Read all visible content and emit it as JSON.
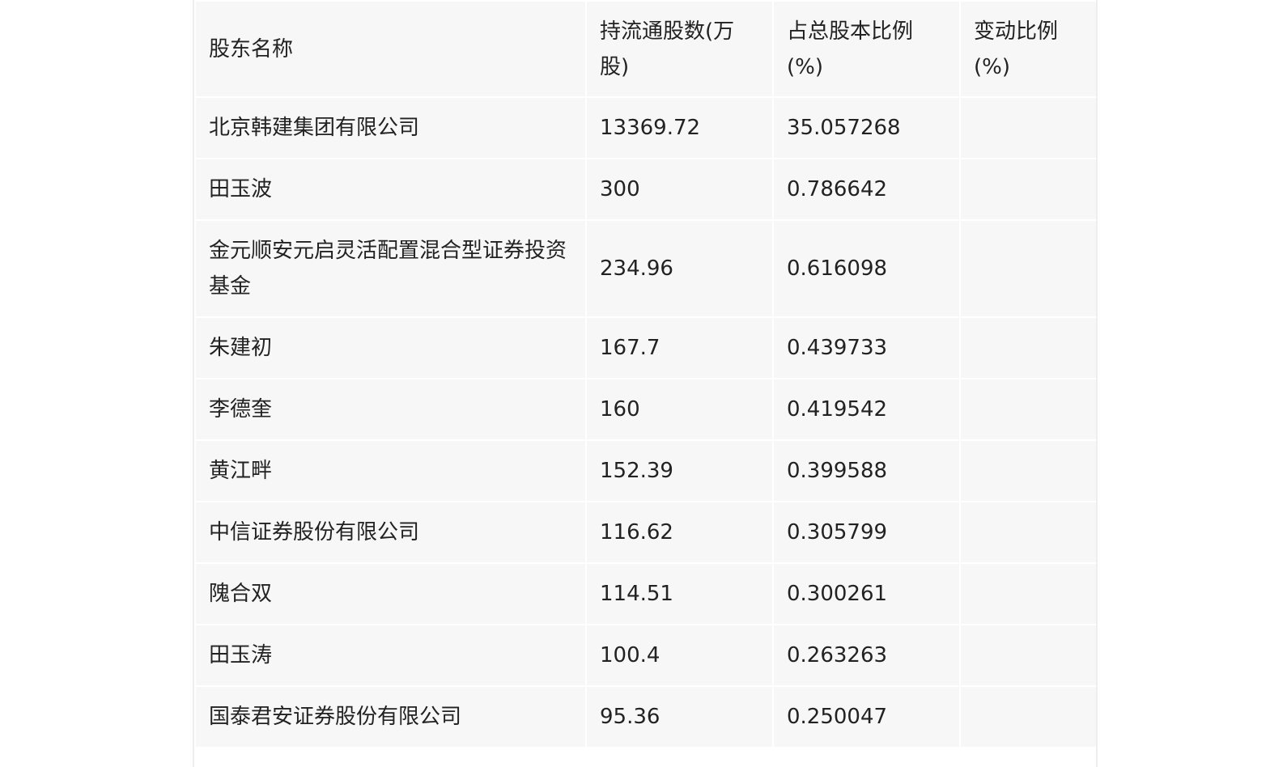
{
  "table": {
    "headers": {
      "name": "股东名称",
      "shares": "持流通股数(万股)",
      "pct": "占总股本比例(%)",
      "change": "变动比例(%)"
    },
    "rows": [
      {
        "name": "北京韩建集团有限公司",
        "shares": "13369.72",
        "pct": "35.057268",
        "change": ""
      },
      {
        "name": "田玉波",
        "shares": "300",
        "pct": "0.786642",
        "change": ""
      },
      {
        "name": "金元顺安元启灵活配置混合型证券投资基金",
        "shares": "234.96",
        "pct": "0.616098",
        "change": ""
      },
      {
        "name": "朱建初",
        "shares": "167.7",
        "pct": "0.439733",
        "change": ""
      },
      {
        "name": "李德奎",
        "shares": "160",
        "pct": "0.419542",
        "change": ""
      },
      {
        "name": "黄江畔",
        "shares": "152.39",
        "pct": "0.399588",
        "change": ""
      },
      {
        "name": "中信证券股份有限公司",
        "shares": "116.62",
        "pct": "0.305799",
        "change": ""
      },
      {
        "name": "隗合双",
        "shares": "114.51",
        "pct": "0.300261",
        "change": ""
      },
      {
        "name": "田玉涛",
        "shares": "100.4",
        "pct": "0.263263",
        "change": ""
      },
      {
        "name": "国泰君安证券股份有限公司",
        "shares": "95.36",
        "pct": "0.250047",
        "change": ""
      }
    ]
  }
}
